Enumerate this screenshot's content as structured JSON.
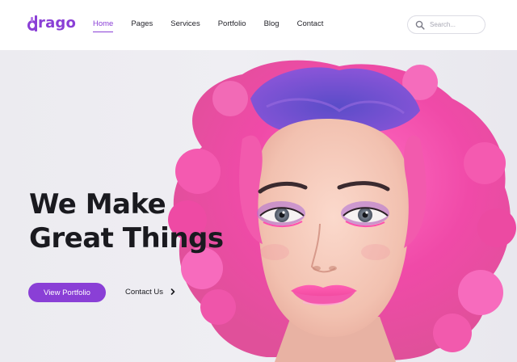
{
  "brand": {
    "logo_text": "rago",
    "logo_alt": "drago",
    "color": "#8a3fd6"
  },
  "nav": {
    "items": [
      {
        "label": "Home",
        "active": true
      },
      {
        "label": "Pages",
        "active": false
      },
      {
        "label": "Services",
        "active": false
      },
      {
        "label": "Portfolio",
        "active": false
      },
      {
        "label": "Blog",
        "active": false
      },
      {
        "label": "Contact",
        "active": false
      }
    ]
  },
  "search": {
    "placeholder": "Search...",
    "value": "",
    "icon": "search-icon"
  },
  "hero": {
    "title_line1": "We Make",
    "title_line2": "Great Things",
    "primary_button": "View Portfolio",
    "secondary_link": "Contact Us",
    "secondary_icon": "chevron-right-icon",
    "image": "portrait-pink-curly-hair"
  },
  "colors": {
    "accent": "#8a3fd6",
    "hair_pink": "#f04aa8",
    "hair_purple": "#6a4bc4",
    "background": "#ecebf0",
    "text": "#1a1a1f"
  }
}
